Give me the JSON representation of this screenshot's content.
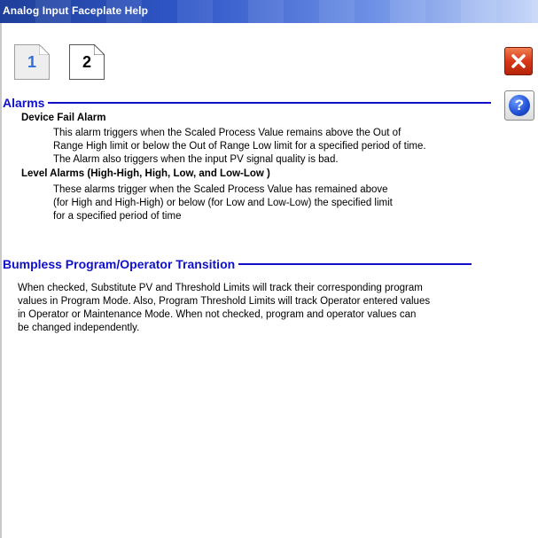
{
  "window": {
    "title": "Analog Input Faceplate Help"
  },
  "page_tabs": [
    {
      "label": "1",
      "selected": false
    },
    {
      "label": "2",
      "selected": true
    }
  ],
  "buttons": {
    "close_icon": "close-icon",
    "help_label": "?"
  },
  "sections": {
    "alarms": {
      "title": "Alarms",
      "device_fail": {
        "heading": "Device Fail Alarm",
        "text": "This alarm triggers when the Scaled Process Value remains above the Out of\nRange High limit or below the Out of Range Low limit for a specified period of time.\nThe Alarm also triggers when the input PV signal quality is bad."
      },
      "level": {
        "heading": "Level Alarms (High-High, High, Low, and Low-Low )",
        "text": "These alarms trigger when the Scaled Process Value has remained above\n(for High and High-High) or below (for Low and Low-Low) the specified limit\nfor a specified period of time"
      }
    },
    "bumpless": {
      "title": "Bumpless Program/Operator Transition",
      "text": "When checked, Substitute PV and Threshold Limits will track their corresponding program\nvalues in Program Mode.  Also, Program Threshold Limits will track Operator entered values\nin Operator or Maintenance Mode.  When not checked, program and operator values can\nbe changed independently."
    }
  },
  "colors": {
    "section_heading": "#1010cc",
    "close_button": "#d9381a",
    "help_button": "#2454d8"
  }
}
